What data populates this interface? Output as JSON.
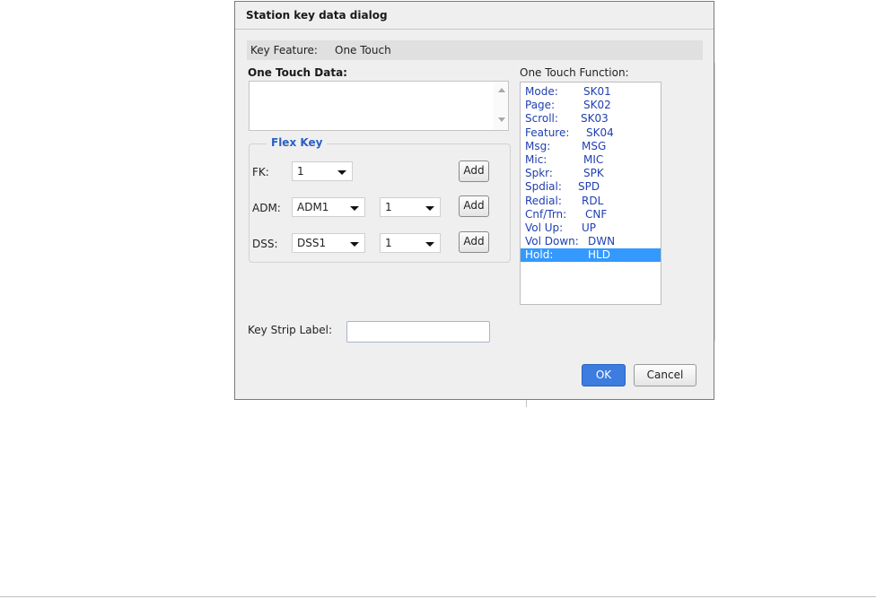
{
  "dialog": {
    "title": "Station key data dialog",
    "key_feature_label": "Key Feature:",
    "key_feature_value": "One Touch",
    "one_touch_data_label": "One Touch Data:",
    "one_touch_data_value": "",
    "flex_key": {
      "legend": "Flex Key",
      "fk_label": "FK:",
      "fk_value": "1",
      "adm_label": "ADM:",
      "adm_value": "ADM1",
      "adm_num_value": "1",
      "dss_label": "DSS:",
      "dss_value": "DSS1",
      "dss_num_value": "1",
      "add_label": "Add"
    },
    "one_touch_function_label": "One Touch Function:",
    "functions": [
      {
        "name": "Mode:",
        "code": "SK01"
      },
      {
        "name": "Page:",
        "code": "SK02"
      },
      {
        "name": "Scroll:",
        "code": "SK03"
      },
      {
        "name": "Feature:",
        "code": "SK04"
      },
      {
        "name": "Msg:",
        "code": "MSG"
      },
      {
        "name": "Mic:",
        "code": "MIC"
      },
      {
        "name": "Spkr:",
        "code": "SPK"
      },
      {
        "name": "Spdial:",
        "code": "SPD"
      },
      {
        "name": "Redial:",
        "code": "RDL"
      },
      {
        "name": "Cnf/Trn:",
        "code": "CNF"
      },
      {
        "name": "Vol Up:",
        "code": "UP"
      },
      {
        "name": "Vol Down:",
        "code": "DWN"
      },
      {
        "name": "Hold:",
        "code": "HLD"
      }
    ],
    "selected_function": "Hold:",
    "key_strip_label": "Key Strip Label:",
    "key_strip_value": "",
    "ok_label": "OK",
    "cancel_label": "Cancel",
    "colors": {
      "selection": "#3399ff",
      "function_text": "#1f3fb0",
      "ok_button": "#3d7de0",
      "legend": "#2b5fc4"
    }
  }
}
